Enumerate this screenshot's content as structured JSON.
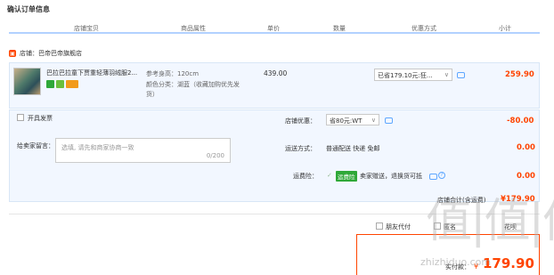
{
  "page_title": "确认订单信息",
  "columns": [
    "店铺宝贝",
    "商品属性",
    "单价",
    "数量",
    "优惠方式",
    "小计"
  ],
  "store": {
    "label": "店铺：巴帝巴帝旗舰店"
  },
  "product": {
    "name": "巴拉巴拉童下贾重轻薄羽绒服2...",
    "prop_size": "参考身高：120cm",
    "prop_color_line1": "颜色分类：湖蓝（收藏加购优先发",
    "prop_color_line2": "货）",
    "unit_price": "439.00",
    "promo_select": "已省179.10元:狂...",
    "subtotal": "259.90",
    "badge_colors": [
      "#2fa838",
      "#6cbf3c",
      "#f29b1a"
    ]
  },
  "options": {
    "invoice_label": "开具发票",
    "message_label": "给卖家留言：",
    "message_placeholder": "选填, 请先和商家协商一致",
    "message_counter": "0/200",
    "store_discount_label": "店铺优惠：",
    "store_discount_select": "省80元:WT",
    "store_discount_amount": "-80.00",
    "shipping_label": "运送方式：",
    "shipping_value": "普通配送 快递 免邮",
    "shipping_amount": "0.00",
    "insurance_label": "运费险：",
    "insurance_tag": "运费险",
    "insurance_text": "卖家赠送，退换货可抵",
    "insurance_amount": "0.00"
  },
  "store_total": {
    "label": "店铺合计(含运费)",
    "value": "¥179.90"
  },
  "bottom": {
    "friend_pay_label": "朋友代付",
    "anon_label": "匿名",
    "partial_text": "花呗",
    "pay_label": "实付款：",
    "pay_currency": "¥",
    "pay_amount": "179.90"
  },
  "watermark": {
    "big": "值|值|值",
    "small": "zhizhiduo.com"
  },
  "colors": {
    "accent": "#ff4400",
    "blue_bg": "#f2f7ff",
    "header_line": "#b2d1ff"
  }
}
